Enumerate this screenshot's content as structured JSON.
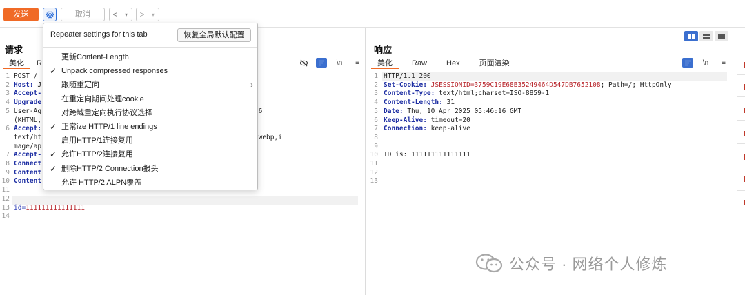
{
  "toolbar": {
    "send_label": "发送",
    "cancel_label": "取消",
    "back_arrow": "<",
    "forward_arrow": ">",
    "dropdown_glyph": "▾"
  },
  "request": {
    "title": "请求",
    "tabs": [
      "美化",
      "R"
    ],
    "line_numbers": [
      "1",
      "2",
      "3",
      "4",
      "5",
      "",
      "6",
      "",
      "",
      "7",
      "8",
      "9",
      "10",
      "11",
      "12",
      "13",
      "14"
    ],
    "lines": [
      "POST /",
      "Host: J",
      "Accept-",
      "Upgrade",
      "User-Ag                                       ppleWebKit/537.36",
      "(KHTML,",
      "Accept:",
      "text/ht                                       mage/avif,image/webp,i",
      "mage/ap                                       0.7",
      "Accept-",
      "Connect",
      "Content",
      "Content",
      "",
      "",
      "id=111111111111111",
      ""
    ]
  },
  "response": {
    "title": "响应",
    "tabs": [
      "美化",
      "Raw",
      "Hex",
      "页面渲染"
    ],
    "line_numbers": [
      "1",
      "2",
      "3",
      "4",
      "5",
      "6",
      "7",
      "8",
      "9",
      "10",
      "11",
      "12",
      "13"
    ],
    "lines": [
      {
        "k": "HTTP/1.1 200",
        "v": ""
      },
      {
        "k": "Set-Cookie: ",
        "v": "JSESSIONID=3759C19E68B35249464D547DB7652108",
        "t": "; Path=/; HttpOnly"
      },
      {
        "k": "Content-Type: ",
        "v": "",
        "t": "text/html;charset=ISO-8859-1"
      },
      {
        "k": "Content-Length: ",
        "v": "",
        "t": "31"
      },
      {
        "k": "Date: ",
        "v": "",
        "t": "Thu, 10 Apr 2025 05:46:16 GMT"
      },
      {
        "k": "Keep-Alive: ",
        "v": "",
        "t": "timeout=20"
      },
      {
        "k": "Connection: ",
        "v": "",
        "t": "keep-alive"
      },
      {
        "k": "",
        "v": "",
        "t": ""
      },
      {
        "k": "",
        "v": "",
        "t": ""
      },
      {
        "k": "",
        "v": "",
        "t": "ID is: 111111111111111"
      },
      {
        "k": "",
        "v": "",
        "t": ""
      },
      {
        "k": "",
        "v": "",
        "t": ""
      },
      {
        "k": "",
        "v": "",
        "t": ""
      }
    ]
  },
  "editor_icons": {
    "wrap": "\\n",
    "menu": "≡"
  },
  "settings_menu": {
    "header": "Repeater settings for this tab",
    "restore_label": "恢复全局默认配置",
    "items": [
      {
        "label": "更新Content-Length",
        "checked": false,
        "submenu": false
      },
      {
        "label": "Unpack compressed responses",
        "checked": true,
        "submenu": false
      },
      {
        "label": "跟随重定向",
        "checked": false,
        "submenu": true
      },
      {
        "label": "在重定向期间处理cookie",
        "checked": false,
        "submenu": false
      },
      {
        "label": "对跨域重定向执行协议选择",
        "checked": false,
        "submenu": false
      },
      {
        "label": "正常ize HTTP/1 line endings",
        "checked": true,
        "submenu": false
      },
      {
        "label": "启用HTTP/1连接复用",
        "checked": false,
        "submenu": false
      },
      {
        "label": "允许HTTP/2连接复用",
        "checked": true,
        "submenu": false
      },
      {
        "label": "删除HTTP/2 Connection报头",
        "checked": true,
        "submenu": false
      },
      {
        "label": "允许 HTTP/2 ALPN覆盖",
        "checked": false,
        "submenu": false
      }
    ],
    "check_glyph": "✓",
    "submenu_glyph": "›"
  },
  "watermark": {
    "text": "公众号 · 网络个人修炼"
  },
  "colors": {
    "accent": "#f06a26",
    "blue": "#3b6fcf",
    "header_key": "#1e2fa3",
    "value_red": "#b8262c"
  }
}
